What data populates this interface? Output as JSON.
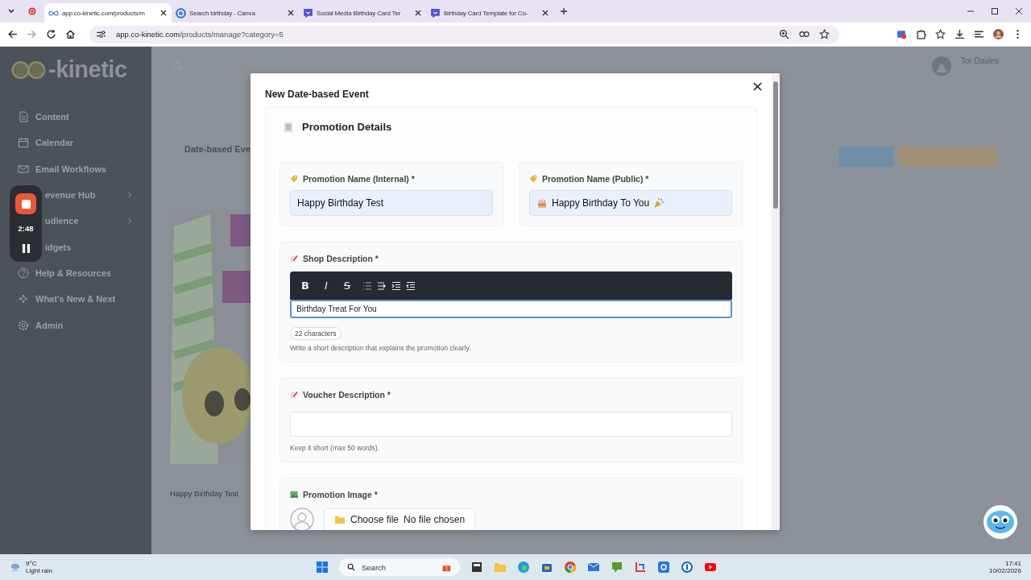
{
  "browser": {
    "tabs": [
      {
        "title": "app.co-kinetic.com/products/m",
        "kind": "site",
        "selected": true
      },
      {
        "title": "Search birthday - Canva",
        "kind": "canva",
        "selected": false
      },
      {
        "title": "Social Media Birthday Card Ter",
        "kind": "doc",
        "selected": false
      },
      {
        "title": "Birthday Card Template for Co-",
        "kind": "doc",
        "selected": false
      }
    ],
    "address": {
      "host": "app.co-kinetic.com",
      "path": "/products/manage?category=5"
    }
  },
  "sidebar": {
    "logo": "-kinetic",
    "items": [
      {
        "label": "Content",
        "kind": "doc",
        "expandable": false
      },
      {
        "label": "Calendar",
        "kind": "calendar",
        "expandable": false
      },
      {
        "label": "Email Workflows",
        "kind": "mail",
        "expandable": false
      },
      {
        "label": "evenue Hub",
        "kind": "covered",
        "expandable": true
      },
      {
        "label": "udience",
        "kind": "covered",
        "expandable": true
      },
      {
        "label": "idgets",
        "kind": "covered",
        "expandable": false
      },
      {
        "label": "Help & Resources",
        "kind": "help",
        "expandable": false
      },
      {
        "label": "What's New & Next",
        "kind": "sparkle",
        "expandable": false
      },
      {
        "label": "Admin",
        "kind": "gear",
        "expandable": false
      }
    ]
  },
  "recorder": {
    "time": "2:48"
  },
  "page": {
    "user": "Tor Davies",
    "heading": "Date-based Eve",
    "card_caption": "Happy Birthday Test"
  },
  "modal": {
    "title": "New Date-based Event",
    "section": "Promotion Details",
    "name_fields": [
      {
        "label": "Promotion Name (Internal) *",
        "value": "Happy Birthday Test",
        "decorated": false
      },
      {
        "label": "Promotion Name (Public) *",
        "value": "Happy Birthday To You",
        "decorated": true
      }
    ],
    "shop": {
      "label": "Shop Description *",
      "toolbar": [
        {
          "kind": "bold",
          "glyph": "B"
        },
        {
          "kind": "italic",
          "glyph": "I"
        },
        {
          "kind": "strike",
          "glyph": "S"
        },
        {
          "kind": "list"
        },
        {
          "kind": "indent"
        },
        {
          "kind": "outdent"
        },
        {
          "kind": "indent2"
        }
      ],
      "value": "Birthday Treat For You",
      "count": "22 characters",
      "hint": "Write a short description that explains the promotion clearly."
    },
    "voucher": {
      "label": "Voucher Description *",
      "hint": "Keep it short (max 50 words)."
    },
    "image": {
      "label": "Promotion Image *",
      "button": "Choose file",
      "status": "No file chosen"
    }
  },
  "taskbar": {
    "temperature": "9°C",
    "weather": "Light rain",
    "search": "Search",
    "time": "17:41",
    "date": "10/02/2026"
  }
}
